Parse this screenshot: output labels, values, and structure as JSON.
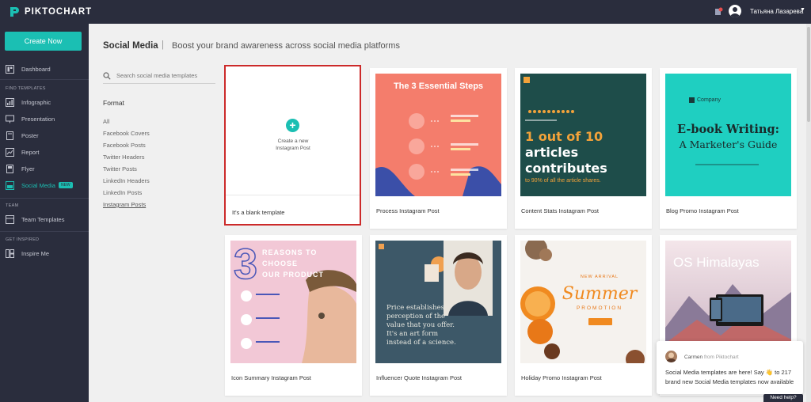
{
  "app": {
    "brand": "PIKTOCHART",
    "user_name": "Татьяна Лазарева",
    "accent": "#1bbfb3",
    "sidebar_bg": "#2a2d3d"
  },
  "sidebar": {
    "create_label": "Create Now",
    "dashboard": "Dashboard",
    "find_templates_label": "FIND TEMPLATES",
    "template_items": [
      {
        "label": "Infographic",
        "icon": "infographic-icon"
      },
      {
        "label": "Presentation",
        "icon": "presentation-icon"
      },
      {
        "label": "Poster",
        "icon": "poster-icon"
      },
      {
        "label": "Report",
        "icon": "report-icon"
      },
      {
        "label": "Flyer",
        "icon": "flyer-icon"
      },
      {
        "label": "Social Media",
        "icon": "social-media-icon",
        "badge": "NEW",
        "active": true
      }
    ],
    "team_label": "TEAM",
    "team_templates": "Team Templates",
    "get_inspired_label": "GET INSPIRED",
    "inspire_me": "Inspire Me"
  },
  "main": {
    "title": "Social Media",
    "separator": "|",
    "subtitle": "Boost your brand awareness across social media platforms",
    "search_placeholder": "Search social media templates",
    "format_title": "Format",
    "filters": [
      "All",
      "Facebook Covers",
      "Facebook Posts",
      "Twitter Headers",
      "Twitter Posts",
      "LinkedIn Headers",
      "LinkedIn Posts",
      "Instagram Posts"
    ],
    "selected_filter": "Instagram Posts"
  },
  "cards": {
    "blank": {
      "create_line1": "Create a new",
      "create_line2": "Instagram Post",
      "caption": "It's a blank template"
    },
    "process": {
      "caption": "Process Instagram Post",
      "heading": "The 3 Essential Steps"
    },
    "content_stats": {
      "caption": "Content Stats Instagram Post",
      "line1": "1 out of 10",
      "line2": "articles",
      "line3": "contributes",
      "line4": "to 90% of all the article shares."
    },
    "blog_promo": {
      "caption": "Blog Promo Instagram Post",
      "company": "Company",
      "line1": "E-book Writing:",
      "line2": "A Marketer's Guide"
    },
    "icon_summary": {
      "caption": "Icon Summary Instagram Post",
      "line1": "REASONS TO",
      "line2": "CHOOSE",
      "line3": "OUR PRODUCT"
    },
    "influencer": {
      "caption": "Influencer Quote Instagram Post",
      "quote1": "Price establishes",
      "quote2": "perception of the",
      "quote3": "value that you offer.",
      "quote4": "It's an art form",
      "quote5": "instead of a science."
    },
    "holiday": {
      "caption": "Holiday Promo Instagram Post",
      "tag": "NEW ARRIVAL",
      "word": "Summer",
      "sub": "PROMOTION"
    },
    "travel": {
      "title": "OS Himalayas"
    }
  },
  "chat": {
    "name": "Carmen",
    "from": "from Piktochart",
    "message": "Social Media templates are here! Say 👋 to 217 brand new Social Media templates now available"
  },
  "help_label": "Need help?"
}
